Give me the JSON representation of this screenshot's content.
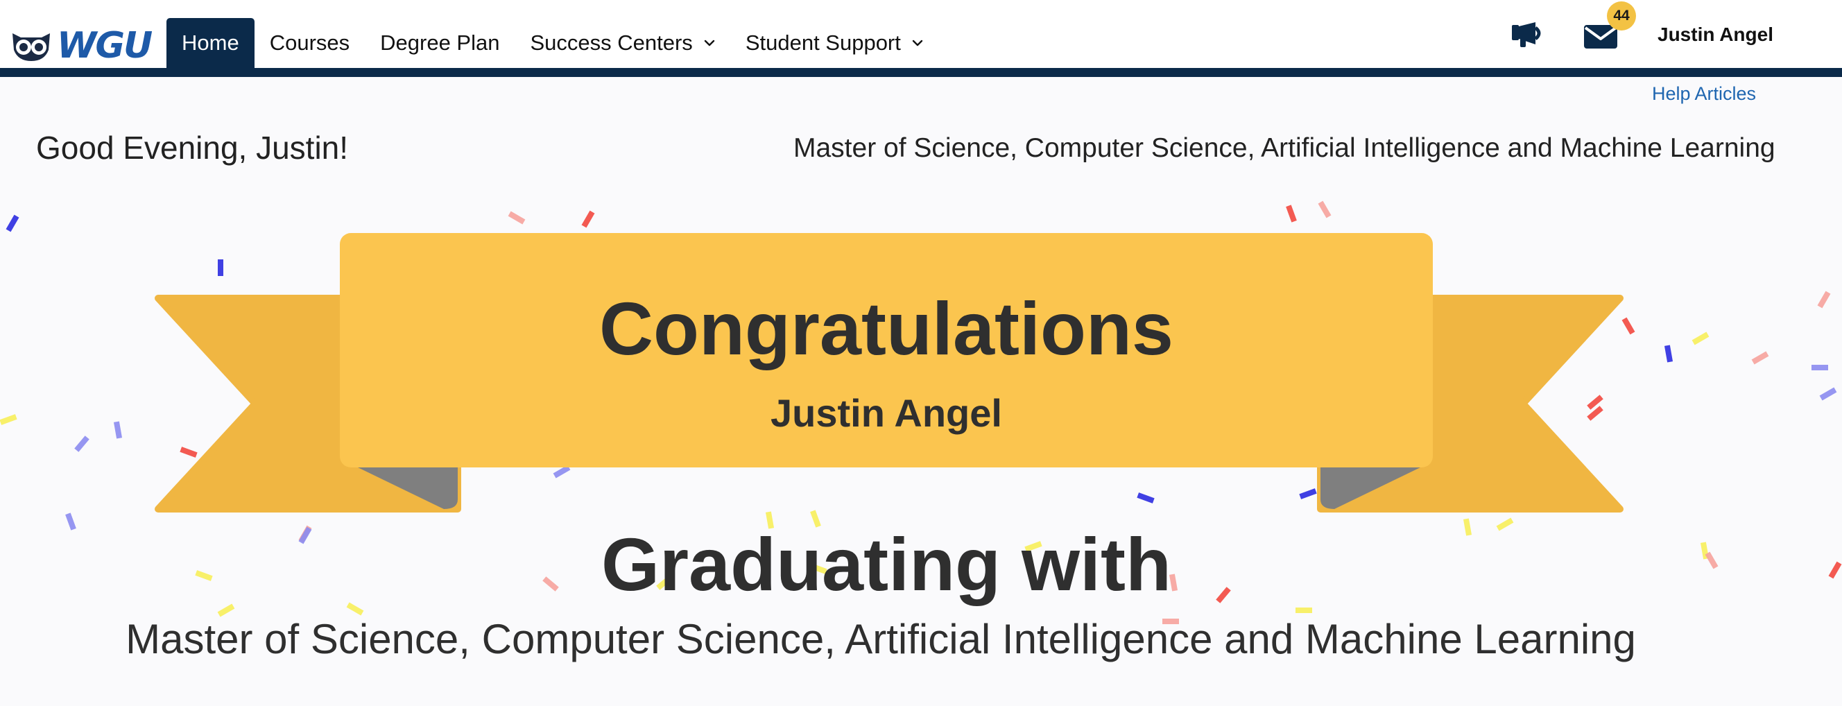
{
  "brand": {
    "logo_text": "WGU",
    "accent_color": "#0b2a4a",
    "logo_color": "#1e5aa8"
  },
  "nav": {
    "items": [
      {
        "label": "Home",
        "active": true,
        "has_dropdown": false
      },
      {
        "label": "Courses",
        "active": false,
        "has_dropdown": false
      },
      {
        "label": "Degree Plan",
        "active": false,
        "has_dropdown": false
      },
      {
        "label": "Success Centers",
        "active": false,
        "has_dropdown": true
      },
      {
        "label": "Student Support",
        "active": false,
        "has_dropdown": true
      }
    ],
    "icons": [
      "megaphone-icon",
      "mail-icon"
    ],
    "mail_count": "44",
    "user_name": "Justin Angel"
  },
  "subheader": {
    "help_link": "Help Articles",
    "greeting": "Good Evening, Justin!",
    "program": "Master of Science, Computer Science, Artificial Intelligence and Machine Learning"
  },
  "banner": {
    "title": "Congratulations",
    "name": "Justin Angel",
    "ribbon_color": "#fbc54f",
    "ribbon_tail_color": "#f0b642",
    "fold_color": "#7f7f7f"
  },
  "graduation": {
    "heading": "Graduating with",
    "program": "Master of Science, Computer Science, Artificial Intelligence and Machine Learning"
  },
  "confetti_colors": [
    "#2b2be0",
    "#f2483f",
    "#f6a29c",
    "#f7ee5a",
    "#8b8bf0"
  ]
}
